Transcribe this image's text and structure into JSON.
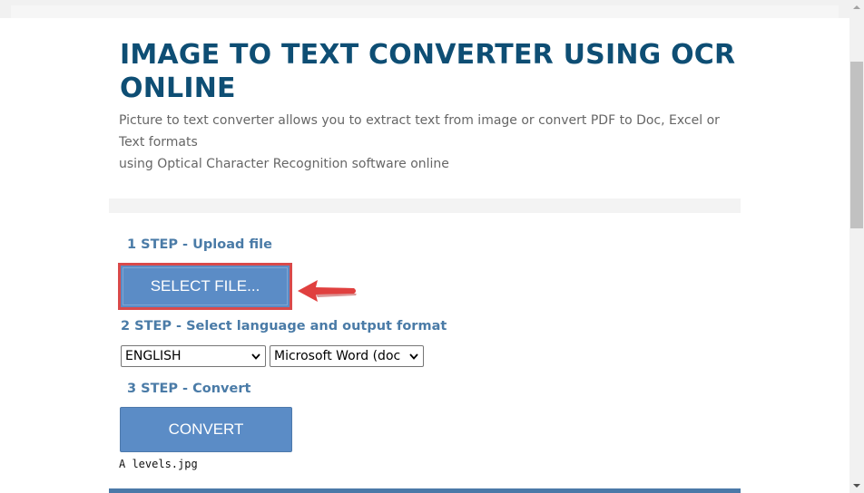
{
  "header": {
    "title": "IMAGE TO TEXT CONVERTER USING OCR ONLINE",
    "description_lines": [
      "Picture to text converter allows you to extract text from image or convert PDF to Doc, Excel or Text formats",
      "using Optical Character Recognition software online"
    ]
  },
  "steps": {
    "step1_label": "1 STEP - Upload file",
    "step2_label": "2 STEP - Select language and output format",
    "step3_label": "3 STEP - Convert"
  },
  "upload": {
    "select_file_label": "SELECT FILE...",
    "selected_file": "A levels.jpg"
  },
  "options": {
    "language": "ENGLISH",
    "output_format": "Microsoft Word (doc"
  },
  "convert": {
    "label": "CONVERT"
  },
  "colors": {
    "title": "#0e4e74",
    "step_label": "#4a7ba7",
    "button": "#5b8cc6",
    "highlight_border": "#d9494a",
    "bottom_bar": "#4b79a8"
  },
  "icons": {
    "annotation": "left-arrow-icon",
    "dropdown": "chevron-down-icon",
    "scroll_up": "scroll-up-icon",
    "scroll_down": "scroll-down-icon"
  }
}
